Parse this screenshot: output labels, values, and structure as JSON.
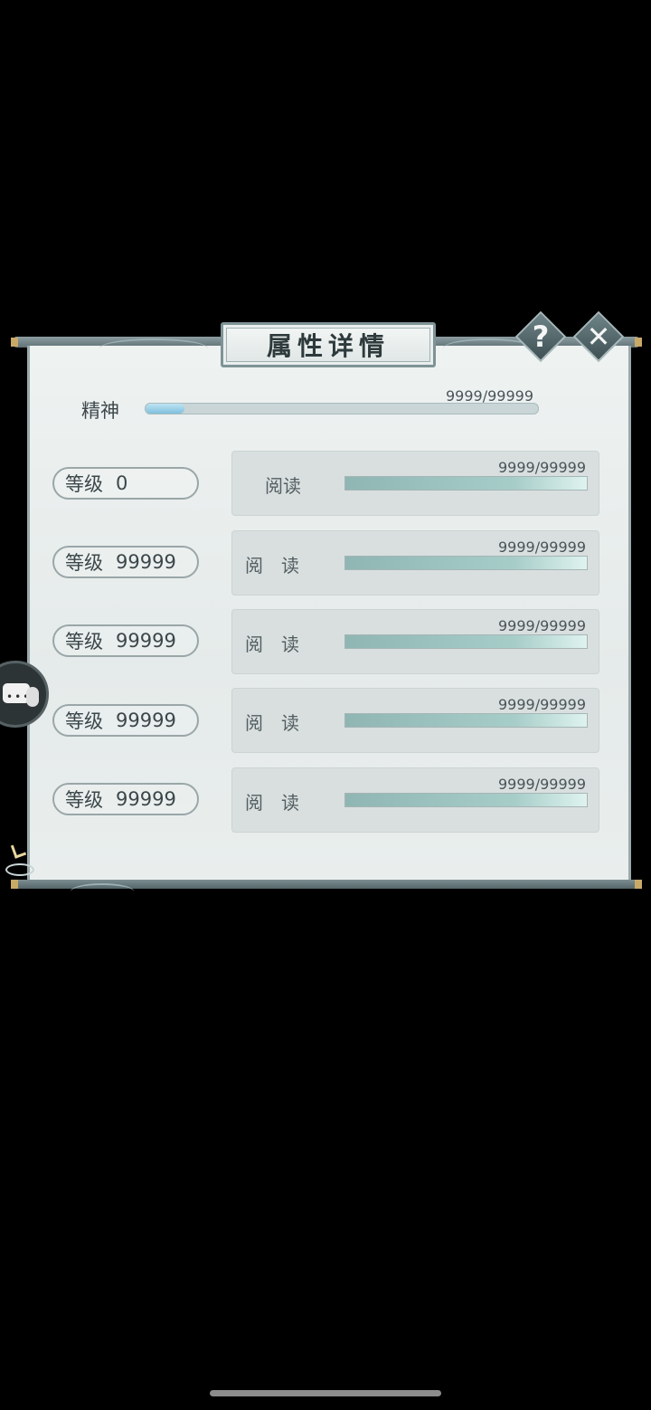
{
  "dialog": {
    "title": "属性详情",
    "help_glyph": "?",
    "close_glyph": "✕"
  },
  "spirit": {
    "label": "精神",
    "value_text": "9999/99999",
    "progress": 0.1
  },
  "rows": [
    {
      "level_label": "等级",
      "level_value": "0",
      "action_label": "阅读",
      "value_text": "9999/99999",
      "progress": 1.0
    },
    {
      "level_label": "等级",
      "level_value": "99999",
      "action_label": "阅　读",
      "value_text": "9999/99999",
      "progress": 1.0
    },
    {
      "level_label": "等级",
      "level_value": "99999",
      "action_label": "阅　读",
      "value_text": "9999/99999",
      "progress": 1.0
    },
    {
      "level_label": "等级",
      "level_value": "99999",
      "action_label": "阅　读",
      "value_text": "9999/99999",
      "progress": 1.0
    },
    {
      "level_label": "等级",
      "level_value": "99999",
      "action_label": "阅　读",
      "value_text": "9999/99999",
      "progress": 1.0
    }
  ],
  "side_chat": {
    "dots": "•••"
  },
  "colors": {
    "spirit_fill": "#7fc0dd",
    "row_fill": "#a7cdc9",
    "frame": "#5f7276"
  }
}
